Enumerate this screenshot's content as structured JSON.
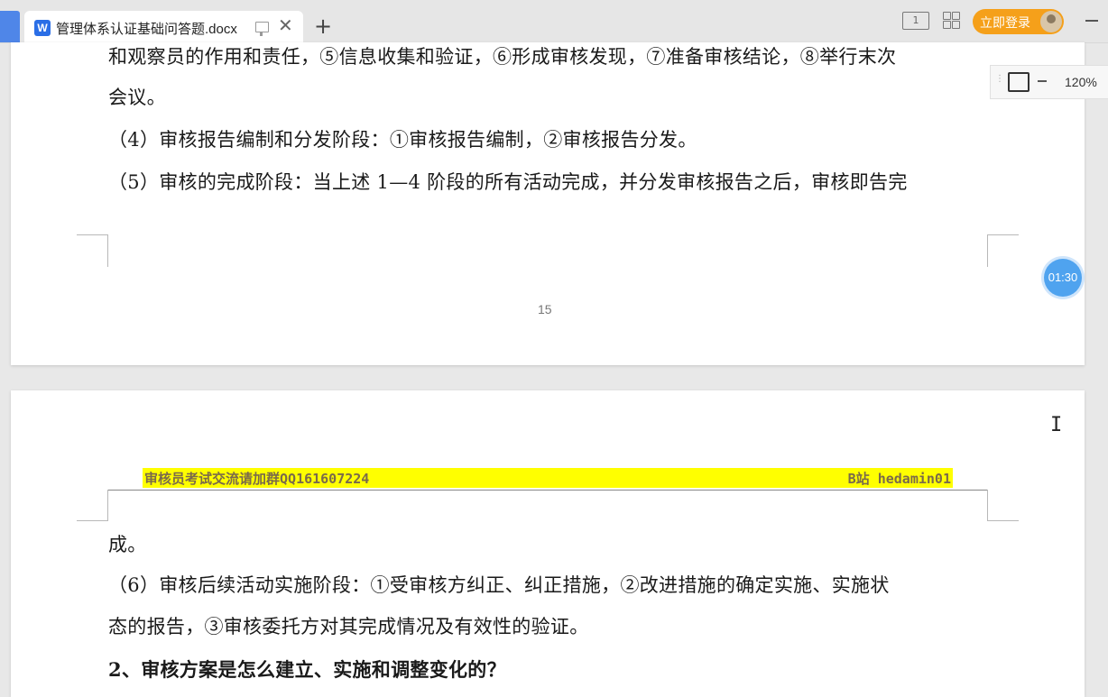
{
  "tab": {
    "title": "管理体系认证基础问答题.docx",
    "close_glyph": "✕",
    "new_tab_glyph": "+"
  },
  "toolbar": {
    "book_icon_text": "1",
    "login_label": "立即登录"
  },
  "zoom": {
    "value": "120%"
  },
  "timer": {
    "value": "01:30"
  },
  "page1": {
    "lines": [
      "和观察员的作用和责任，⑤信息收集和验证，⑥形成审核发现，⑦准备审核结论，⑧举行末次",
      "会议。",
      "（4）审核报告编制和分发阶段：①审核报告编制，②审核报告分发。",
      "（5）审核的完成阶段：当上述 1—4 阶段的所有活动完成，并分发审核报告之后，审核即告完"
    ],
    "page_number": "15"
  },
  "page2": {
    "header_left": "审核员考试交流请加群QQ161607224",
    "header_right": "B站 hedamin01",
    "lines": [
      "成。",
      "（6）审核后续活动实施阶段：①受审核方纠正、纠正措施，②改进措施的确定实施、实施状",
      "态的报告，③审核委托方对其完成情况及有效性的验证。",
      "2、审核方案是怎么建立、实施和调整变化的？"
    ]
  }
}
